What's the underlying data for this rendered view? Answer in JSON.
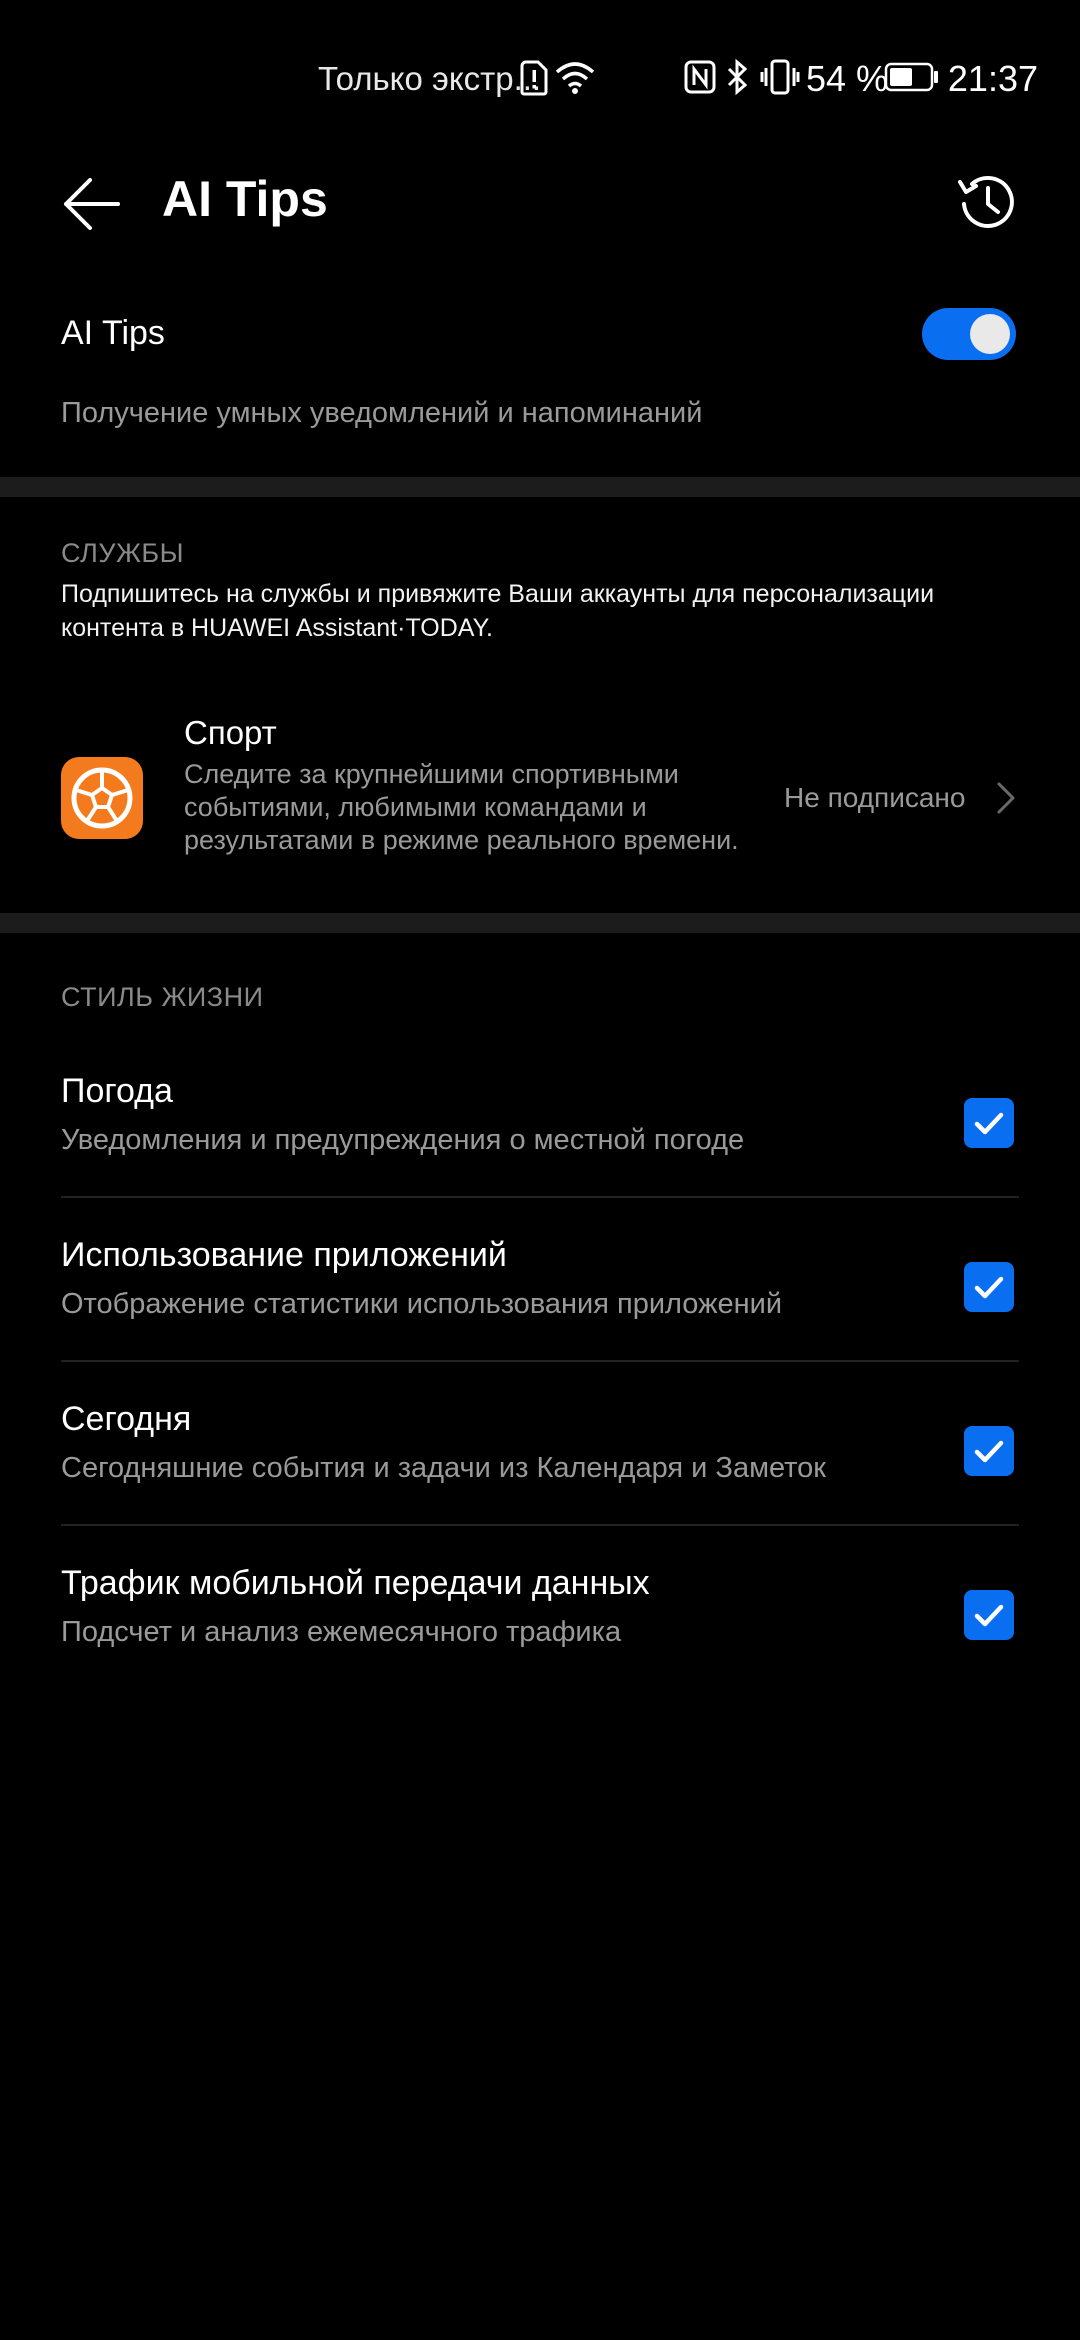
{
  "status_bar": {
    "carrier_text": "Только экстр...",
    "battery_percent": "54 %",
    "time": "21:37",
    "icons": [
      "sim-alert-icon",
      "wifi-icon",
      "nfc-icon",
      "bluetooth-icon",
      "vibrate-icon",
      "battery-icon"
    ]
  },
  "app_bar": {
    "title": "AI Tips",
    "back_icon": "arrow-left-icon",
    "history_icon": "history-clock-icon"
  },
  "ai_tips_toggle": {
    "label": "AI Tips",
    "description": "Получение умных уведомлений и напоминаний",
    "enabled": true
  },
  "services": {
    "section_title": "СЛУЖБЫ",
    "description": "Подпишитесь на службы и привяжите Ваши аккаунты для персонализации контента в HUAWEI Assistant·TODAY.",
    "sport": {
      "title": "Спорт",
      "description": "Следите за крупнейшими спортивными событиями, любимыми командами и результатами в режиме реального времени.",
      "status": "Не подписано",
      "icon": "soccer-ball-icon",
      "icon_color": "#f47a1e"
    }
  },
  "lifestyle": {
    "section_title": "СТИЛЬ ЖИЗНИ",
    "items": [
      {
        "title": "Погода",
        "description": "Уведомления и предупреждения о местной погоде",
        "checked": true
      },
      {
        "title": "Использование приложений",
        "description": "Отображение статистики использования приложений",
        "checked": true
      },
      {
        "title": "Сегодня",
        "description": "Сегодняшние события и задачи из Календаря и Заметок",
        "checked": true
      },
      {
        "title": "Трафик мобильной передачи данных",
        "description": "Подсчет и анализ ежемесячного трафика",
        "checked": true
      }
    ]
  },
  "colors": {
    "accent": "#0a6ef0",
    "background": "#000000",
    "secondary_text": "#9a9a9a"
  }
}
